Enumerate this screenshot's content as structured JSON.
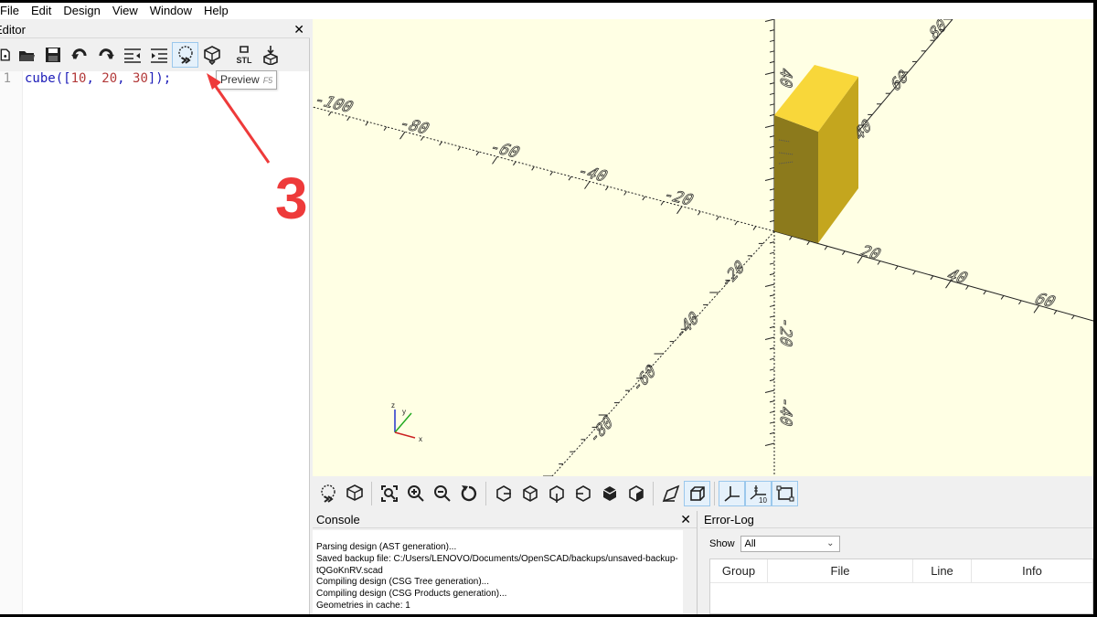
{
  "menu": [
    "File",
    "Edit",
    "Design",
    "View",
    "Window",
    "Help"
  ],
  "editor": {
    "title": "Editor",
    "close": "✕",
    "line_number": "1",
    "code": {
      "fn": "cube",
      "open": "([",
      "n1": "10",
      "n2": "20",
      "n3": "30",
      "close": "]);",
      "sep": ", "
    },
    "tooltip": {
      "label": "Preview",
      "key": "F5"
    }
  },
  "toolbar_icons": [
    "new-icon",
    "open-icon",
    "save-icon",
    "undo-icon",
    "redo-icon",
    "unindent-icon",
    "indent-icon",
    "preview-icon",
    "render-icon",
    "export-stl-icon",
    "send-to-printer-icon"
  ],
  "stl_label": "STL",
  "annotation": {
    "number": "3",
    "color": "#ee3a3a"
  },
  "viewport": {
    "background": "#ffffe4",
    "cube_colors": {
      "top": "#f8d73a",
      "front": "#8c7a1c",
      "right": "#c4a61e"
    },
    "axis_labels": {
      "x_neg": [
        "-100",
        "-80",
        "-60",
        "-40",
        "-20"
      ],
      "x_pos": [
        "20",
        "40",
        "60"
      ],
      "z_pos": [
        "40"
      ],
      "z_neg": [
        "-20",
        "-40"
      ],
      "y_neg": [
        "-20",
        "-40",
        "-60",
        "-80"
      ],
      "y_pos": [
        "80",
        "60",
        "40"
      ]
    },
    "gizmo": {
      "z": "z",
      "y": "y",
      "x": "x"
    }
  },
  "view_toolbar_icons": [
    "preview-icon",
    "render-icon",
    "view-all-icon",
    "zoom-in-icon",
    "zoom-out-icon",
    "reset-view-icon",
    "view-right-icon",
    "view-top-icon",
    "view-bottom-icon",
    "view-left-icon",
    "view-front-icon",
    "view-back-icon",
    "perspective-icon",
    "orthogonal-icon",
    "show-axes-icon",
    "show-scale-markers-icon",
    "show-edges-icon"
  ],
  "console": {
    "title": "Console",
    "close": "✕",
    "lines": [
      "Parsing design (AST generation)...",
      "Saved backup file: C:/Users/LENOVO/Documents/OpenSCAD/backups/unsaved-backup-",
      "tQGoKnRV.scad",
      "Compiling design (CSG Tree generation)...",
      "Compiling design (CSG Products generation)...",
      "Geometries in cache: 1"
    ]
  },
  "errorlog": {
    "title": "Error-Log",
    "show_label": "Show",
    "filter_value": "All",
    "columns": [
      "Group",
      "File",
      "Line",
      "Info"
    ]
  }
}
